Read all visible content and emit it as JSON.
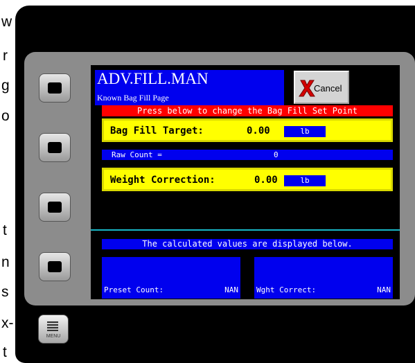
{
  "side_text": [
    "w",
    "r",
    "g",
    "o",
    "t",
    "n",
    "s",
    "x-",
    "t"
  ],
  "header": {
    "title": "ADV.FILL.MAN",
    "subtitle": "Known Bag Fill Page",
    "cancel_label": "Cancel"
  },
  "instruction": "Press below to change the Bag Fill Set Point",
  "bag_fill": {
    "label": "Bag Fill Target:",
    "value": "0.00",
    "unit": "lb"
  },
  "raw_count": {
    "label": "Raw Count =",
    "value": "0"
  },
  "weight_correction": {
    "label": "Weight Correction:",
    "value": "0.00",
    "unit": "lb"
  },
  "calc_note": "The calculated values are displayed below.",
  "results": {
    "preset_count": {
      "label": "Preset Count:",
      "value": "NAN"
    },
    "wght_correct": {
      "label": "Wght Correct:",
      "value": "NAN"
    }
  },
  "menu_label": "MENU",
  "colors": {
    "screen_blue": "#0000ee",
    "highlight_yellow": "#ffff00",
    "alert_red": "#ff0000",
    "divider_cyan": "#18b6c6",
    "bezel_gray": "#8c8c8c"
  },
  "icons": {
    "cancel": "red-x-icon",
    "menu": "menu-icon",
    "softkeys": "softkey-square-icon"
  }
}
